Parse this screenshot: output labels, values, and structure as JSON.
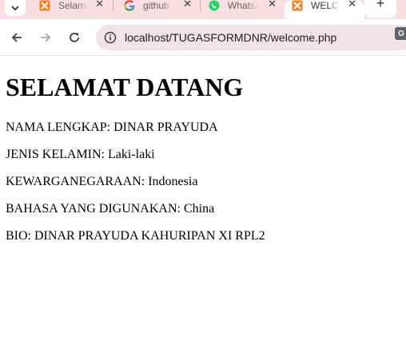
{
  "browser": {
    "tabs": [
      {
        "title": "Selamat Datang",
        "icon": "xampp-icon",
        "active": false
      },
      {
        "title": "github",
        "icon": "google-icon",
        "active": false
      },
      {
        "title": "WhatsApp",
        "icon": "whatsapp-icon",
        "active": false
      },
      {
        "title": "WELCOME",
        "icon": "xampp-icon",
        "active": true
      }
    ],
    "url": "localhost/TUGASFORMDNR/welcome.php",
    "colors": {
      "tabstrip": "#f9dfe4",
      "omnibox": "#f1e4e8",
      "xampp": "#fb7a24",
      "whatsapp": "#25d366"
    }
  },
  "page": {
    "heading": "SELAMAT DATANG",
    "lines": [
      "NAMA LENGKAP: DINAR PRAYUDA",
      "JENIS KELAMIN: Laki-laki",
      "KEWARGANEGARAAN: Indonesia",
      "BAHASA YANG DIGUNAKAN: China",
      "BIO: DINAR PRAYUDA KAHURIPAN XI RPL2"
    ]
  }
}
